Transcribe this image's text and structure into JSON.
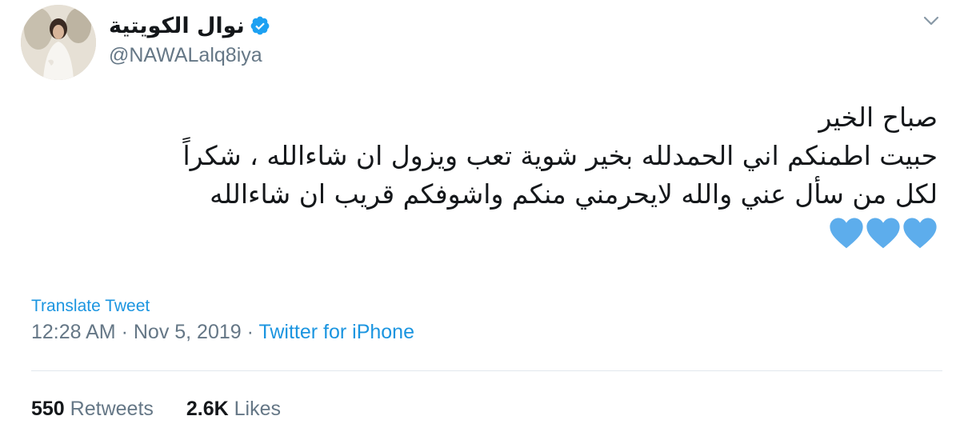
{
  "author": {
    "display_name": "نوال الكويتية",
    "handle": "@NAWALalq8iya",
    "verified": true
  },
  "tweet": {
    "lines": [
      "صباح الخير",
      "حبيت اطمنكم اني الحمدلله بخير شوية تعب ويزول ان شاءالله ، شكراً",
      "لكل من سأل عني والله لايحرمني منكم واشوفكم قريب ان شاءالله"
    ],
    "emoji": [
      "blue-heart-icon",
      "blue-heart-icon",
      "blue-heart-icon"
    ]
  },
  "translate_label": "Translate Tweet",
  "meta": {
    "time": "12:28 AM",
    "separator": " · ",
    "date": "Nov 5, 2019",
    "source": "Twitter for iPhone"
  },
  "stats": {
    "retweets_count": "550",
    "retweets_label": "Retweets",
    "likes_count": "2.6K",
    "likes_label": "Likes"
  },
  "colors": {
    "link": "#1b95e0",
    "muted": "#657786",
    "text": "#14171a",
    "heart": "#5dadec",
    "verified": "#1da1f2"
  }
}
